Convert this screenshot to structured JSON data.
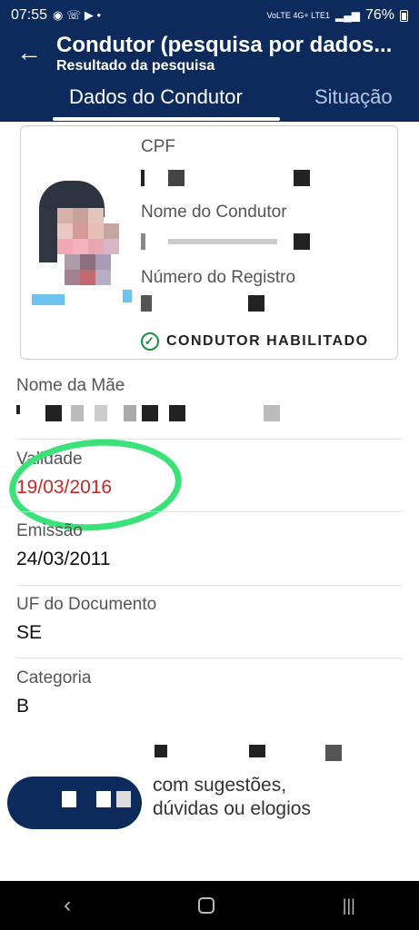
{
  "status_bar": {
    "time": "07:55",
    "network": "VoLTE 4G+ LTE1",
    "battery": "76%"
  },
  "header": {
    "title": "Condutor (pesquisa por dados...",
    "subtitle": "Resultado da pesquisa",
    "tabs": [
      {
        "label": "Dados do Condutor",
        "active": true
      },
      {
        "label": "Situação",
        "active": false
      }
    ]
  },
  "card": {
    "cpf_label": "CPF",
    "name_label": "Nome do Condutor",
    "registro_label": "Número do Registro",
    "status": "CONDUTOR HABILITADO"
  },
  "fields": [
    {
      "label": "Nome da Mãe",
      "value": ""
    },
    {
      "label": "Validade",
      "value": "19/03/2016"
    },
    {
      "label": "Emissão",
      "value": "24/03/2011"
    },
    {
      "label": "UF do Documento",
      "value": "SE"
    },
    {
      "label": "Categoria",
      "value": "B"
    }
  ],
  "fab": {
    "text_line1": "com sugestões,",
    "text_line2": "dúvidas ou elogios"
  },
  "colors": {
    "header": "#0d2a5c",
    "expired": "#c62828",
    "highlight": "#3be27a",
    "status_ok": "#1e8e3e"
  },
  "icons": [
    "back-arrow-icon",
    "check-circle-icon",
    "nav-back-icon",
    "nav-home-icon",
    "nav-recents-icon"
  ]
}
